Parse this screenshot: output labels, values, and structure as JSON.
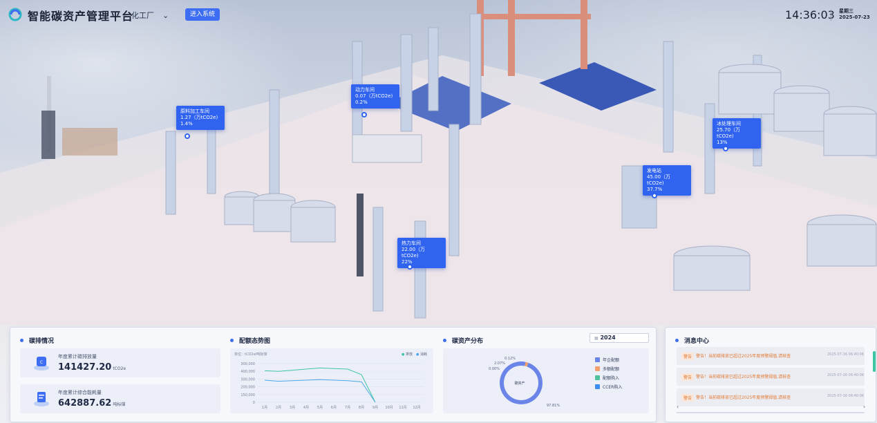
{
  "header": {
    "app_title": "智能碳资产管理平台",
    "plant_selector": "化工厂",
    "enter_button": "进入系统",
    "clock": "14:36:03",
    "weekday": "星期三",
    "date": "2025-07-23"
  },
  "map_tags": [
    {
      "name": "原料加工车间",
      "value": "1.27（万tCO2e)",
      "percent": "1.4%"
    },
    {
      "name": "动力车间",
      "value": "0.07（万tCO2e)",
      "percent": "0.2%"
    },
    {
      "name": "热力车间",
      "value": "22.00（万tCO2e)",
      "percent": "22%"
    },
    {
      "name": "发电站",
      "value": "45.00（万tCO2e)",
      "percent": "37.7%"
    },
    {
      "name": "冰处理车间",
      "value": "25.70（万tCO2e)",
      "percent": "13%"
    }
  ],
  "emission_panel": {
    "title": "碳排情况",
    "cards": [
      {
        "label": "年度累计碳排放量",
        "value": "141427.20",
        "unit": "tCO2e"
      },
      {
        "label": "年度累计综合能耗量",
        "value": "642887.62",
        "unit": "吨标煤"
      }
    ]
  },
  "quota_panel": {
    "title": "配额态势图",
    "unit_label": "单位：tCO2e/吨标煤",
    "legend": [
      "排放",
      "消耗"
    ]
  },
  "asset_panel": {
    "title": "碳资产分布",
    "year": "2024",
    "center_label": "碳资产",
    "legend": [
      "年企配额",
      "多额配额",
      "配额购入",
      "CCER购入"
    ]
  },
  "message_panel": {
    "title": "消息中心",
    "messages": [
      {
        "level": "警告",
        "text": "警告！当前碳排放已超过2025年度预警阈值,请核查",
        "time": "2025-07-16 06:40:06"
      },
      {
        "level": "警告",
        "text": "警告！当前碳排放已超过2025年度预警阈值,请核查",
        "time": "2025-07-16 06:40:06"
      },
      {
        "level": "警告",
        "text": "警告！当前碳排放已超过2025年度预警阈值,请核查",
        "time": "2025-07-16 06:40:06"
      }
    ]
  },
  "colors": {
    "accent": "#3d6df2",
    "tag": "#2f63f0",
    "warning": "#e07a34"
  },
  "chart_data": [
    {
      "type": "line",
      "categories": [
        "1月",
        "2月",
        "3月",
        "4月",
        "5月",
        "6月",
        "7月",
        "8月",
        "9月",
        "10月",
        "11月",
        "12月"
      ],
      "series": [
        {
          "name": "排放",
          "values": [
            285000,
            280000,
            290000,
            300000,
            310000,
            305000,
            300000,
            250000,
            0,
            null,
            null,
            null
          ]
        },
        {
          "name": "消耗",
          "values": [
            200000,
            190000,
            195000,
            200000,
            205000,
            200000,
            195000,
            185000,
            0,
            null,
            null,
            null
          ]
        }
      ],
      "yticks": [
        "300,000",
        "400,000",
        "300,000",
        "200,000",
        "150,000",
        "0"
      ],
      "ylim": [
        0,
        350000
      ]
    },
    {
      "type": "pie",
      "labels": [
        "年企配额",
        "多额配额",
        "配额购入",
        "CCER购入"
      ],
      "values": [
        97.81,
        2.07,
        0.12,
        0.0
      ],
      "value_labels": [
        "97.81%",
        "2.07%",
        "0.12%",
        "0.00%"
      ]
    }
  ]
}
